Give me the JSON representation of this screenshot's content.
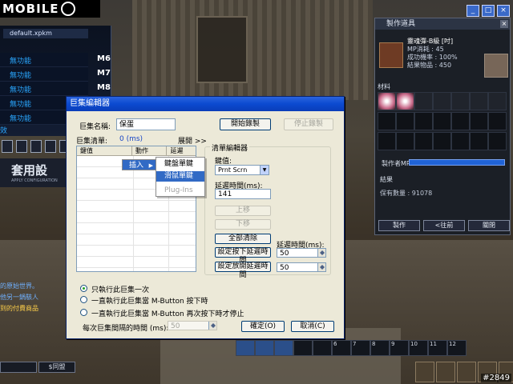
{
  "game": {
    "logo": "MOBILE",
    "macro_file": "default.xpkm",
    "macro_slots": [
      {
        "label": "無功能",
        "key": "M6"
      },
      {
        "label": "無功能",
        "key": "M7"
      },
      {
        "label": "無功能",
        "key": "M8"
      },
      {
        "label": "無功能",
        "key": ""
      },
      {
        "label": "無功能",
        "key": ""
      }
    ],
    "slot_stub": "效",
    "banner": "套用設",
    "banner_sub": "APPLY CONFIGURATION",
    "chat_lines": [
      "的原始世界。",
      "他另一鍋駭人",
      "到的付費商品"
    ],
    "chat_buttons": [
      "",
      "$同盟"
    ],
    "watermark": "#2849",
    "hotbar_numbers": [
      "",
      "",
      "",
      "",
      "",
      "6",
      "7",
      "8",
      "9",
      "10",
      "11",
      "12"
    ]
  },
  "craft_window": {
    "title": "製作道具",
    "item_name": "靈魂彈-B級 [吋]",
    "mp_cost": "MP消耗 : 45",
    "success_rate": "成功機率 : 100%",
    "result_count": "結果物品 : 450",
    "materials_label": "材料",
    "maker_mp_label": "製作者MP",
    "result_label": "結果",
    "owned_text": "保有數量 : 91078",
    "buttons": [
      "製作",
      "<往前",
      "關閉"
    ]
  },
  "dialog": {
    "title": "巨集編輯器",
    "macro_name_label": "巨集名稱:",
    "macro_name_value": "保蛋",
    "start_record": "開始錄製",
    "stop_record": "停止錄製",
    "macro_list_label": "巨集清單:",
    "macro_list_count": "0 (ms)",
    "expand_label": "展開 >>",
    "columns": [
      "鍵值",
      "動作",
      "延遲(ms)"
    ],
    "editor_group": "清單編輯器",
    "key_label": "鍵值:",
    "key_value": "Prnt Scrn",
    "delay_label": "延遲時間(ms):",
    "delay_value": "141",
    "move_up": "上移",
    "move_down": "下移",
    "clear_all": "全部清除",
    "press_delay_btn": "設定按下延遲時間",
    "release_delay_btn": "設定放開延遲時間",
    "delay_label2": "延遲時間(ms):",
    "press_delay_value": "50",
    "release_delay_value": "50",
    "options": [
      "只執行此巨集一次",
      "一直執行此巨集當 M-Button 按下時",
      "一直執行此巨集當 M-Button 再次按下時才停止"
    ],
    "interval_label": "每次巨集間隔的時間 (ms):",
    "interval_value": "50",
    "ok": "確定(O)",
    "cancel": "取消(C)",
    "context_menu": {
      "insert": "插入",
      "items": [
        "鍵盤單鍵",
        "滑鼠單鍵",
        "Plug-Ins"
      ]
    }
  }
}
